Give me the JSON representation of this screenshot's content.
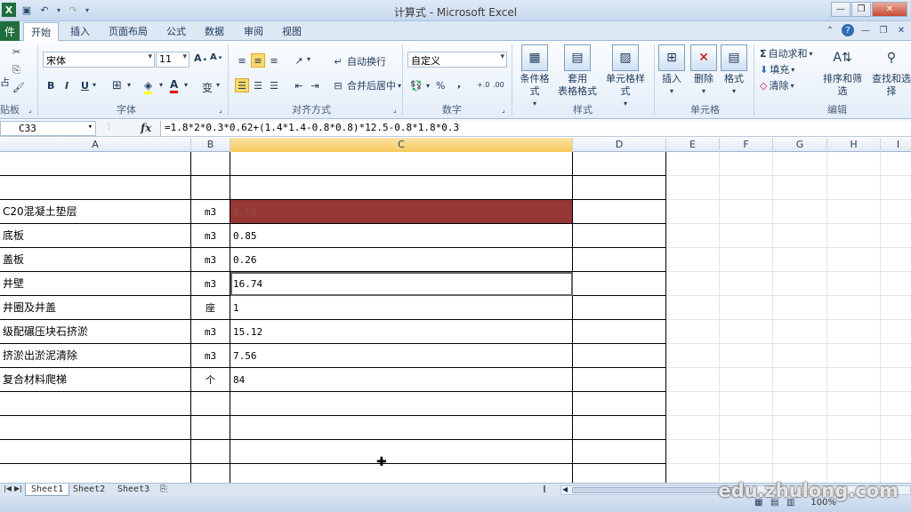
{
  "window": {
    "title": "计算式 - Microsoft Excel"
  },
  "tabs": {
    "file": "件",
    "home": "开始",
    "insert": "插入",
    "page_layout": "页面布局",
    "formulas": "公式",
    "data": "数据",
    "review": "审阅",
    "view": "视图"
  },
  "ribbon": {
    "clipboard": {
      "label": "贴板",
      "paste": "占"
    },
    "font": {
      "label": "字体",
      "font_name": "宋体",
      "font_size": "11",
      "bold": "B",
      "italic": "I",
      "underline": "U",
      "wen": "变"
    },
    "alignment": {
      "label": "对齐方式",
      "wrap_text": "自动换行",
      "merge_center": "合并后居中"
    },
    "number": {
      "label": "数字",
      "format": "自定义",
      "percent": "%",
      "comma": ","
    },
    "styles": {
      "label": "样式",
      "conditional": "条件格式",
      "format_table_1": "套用",
      "format_table_2": "表格格式",
      "cell_styles": "单元格样式"
    },
    "cells": {
      "label": "单元格",
      "insert": "插入",
      "delete": "删除",
      "format": "格式"
    },
    "editing": {
      "label": "编辑",
      "autosum": "自动求和",
      "fill": "填充",
      "clear": "清除",
      "sort_filter": "排序和筛选",
      "find_select": "查找和选择"
    }
  },
  "formula_bar": {
    "name_box": "C33",
    "fx": "fx",
    "formula": "=1.8*2*0.3*0.62+(1.4*1.4-0.8*0.8)*12.5-0.8*1.8*0.3"
  },
  "columns": [
    "A",
    "B",
    "C",
    "D",
    "E",
    "F",
    "G",
    "H",
    "I"
  ],
  "rows": [
    {
      "a": "",
      "b": "",
      "c": ""
    },
    {
      "a": "",
      "b": "",
      "c": ""
    },
    {
      "a": "C20混凝土垫层",
      "b": "m3",
      "c": "0.60"
    },
    {
      "a": "底板",
      "b": "m3",
      "c": "0.85"
    },
    {
      "a": "盖板",
      "b": "m3",
      "c": "0.26"
    },
    {
      "a": "井壁",
      "b": "m3",
      "c": "16.74"
    },
    {
      "a": "井圈及井盖",
      "b": "座",
      "c": "1"
    },
    {
      "a": "级配碾压块石挤淤",
      "b": "m3",
      "c": "15.12"
    },
    {
      "a": "挤淤出淤泥清除",
      "b": "m3",
      "c": "7.56"
    },
    {
      "a": "复合材料爬梯",
      "b": "个",
      "c": "84"
    },
    {
      "a": "",
      "b": "",
      "c": ""
    },
    {
      "a": "",
      "b": "",
      "c": ""
    },
    {
      "a": "",
      "b": "",
      "c": ""
    },
    {
      "a": "",
      "b": "",
      "c": ""
    }
  ],
  "sheets": [
    "Sheet1",
    "Sheet2",
    "Sheet3"
  ],
  "status": {
    "zoom": "100%"
  },
  "watermark": "edu.zhulong.com",
  "colors": {
    "highlight_cell": "#953735",
    "active_col": "#f7c95c"
  }
}
